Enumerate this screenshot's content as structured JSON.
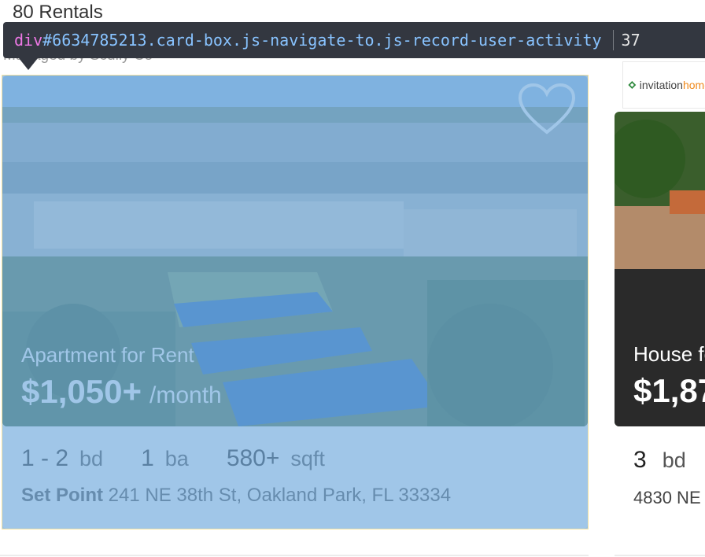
{
  "results": {
    "count_label": "80 Rentals"
  },
  "inspector": {
    "tag": "div",
    "selector": "#6634785213.card-box.js-navigate-to.js-record-user-activity",
    "dimension": "37"
  },
  "card": {
    "managed_by": "Managed by Scully Co",
    "listing_type": "Apartment for Rent",
    "price": "$1,050+",
    "price_unit": "/month",
    "beds_value": "1 - 2",
    "beds_unit": "bd",
    "baths_value": "1",
    "baths_unit": "ba",
    "sqft_value": "580+",
    "sqft_unit": "sqft",
    "community_name": "Set Point",
    "address": " 241 NE 38th St, Oakland Park, FL 33334",
    "favorite_icon": "heart-icon"
  },
  "card2": {
    "logo_text_a": "invitation",
    "logo_text_b": "homes",
    "listing_type": "House fo",
    "price": "$1,87",
    "beds_value": "3",
    "beds_unit": "bd",
    "address": "4830 NE"
  },
  "colors": {
    "highlight": "#6fa8dc",
    "inspector_bg": "#333740",
    "inspector_tag": "#ee78e6",
    "inspector_selector": "#88c3ff"
  }
}
